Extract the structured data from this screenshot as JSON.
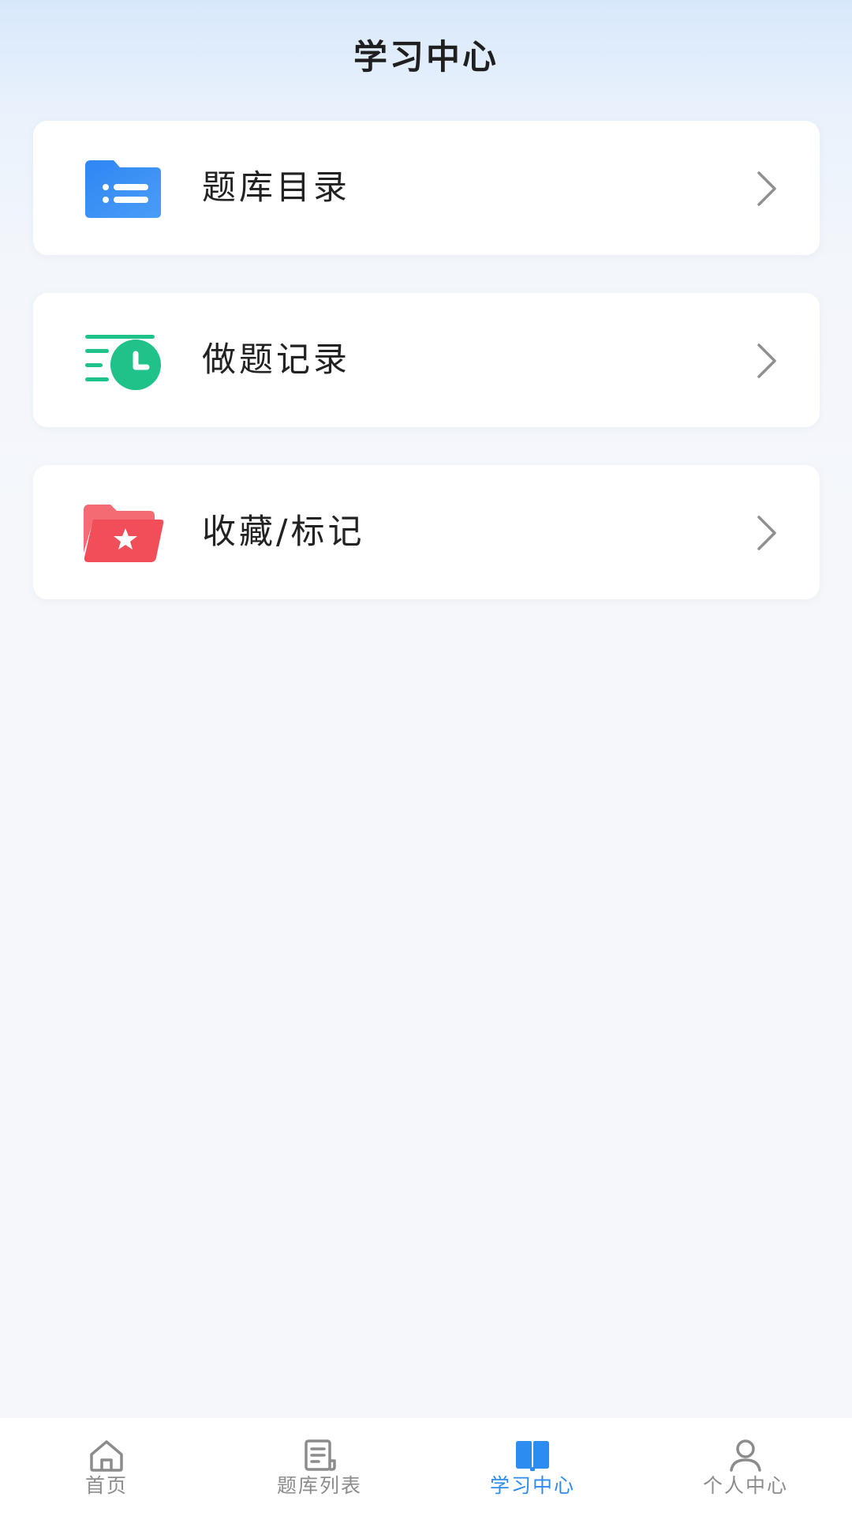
{
  "header": {
    "title": "学习中心"
  },
  "menu": {
    "items": [
      {
        "label": "题库目录",
        "icon": "list-folder-icon",
        "color": "#3a8ef5"
      },
      {
        "label": "做题记录",
        "icon": "history-clock-icon",
        "color": "#1fc38a"
      },
      {
        "label": "收藏/标记",
        "icon": "star-folder-icon",
        "color": "#f2535c"
      }
    ]
  },
  "tabbar": {
    "active_color": "#2d8cf0",
    "inactive_color": "#8c8c8c",
    "tabs": [
      {
        "label": "首页",
        "icon": "home-icon",
        "active": false
      },
      {
        "label": "题库列表",
        "icon": "document-list-icon",
        "active": false
      },
      {
        "label": "学习中心",
        "icon": "open-book-icon",
        "active": true
      },
      {
        "label": "个人中心",
        "icon": "user-icon",
        "active": false
      }
    ]
  }
}
